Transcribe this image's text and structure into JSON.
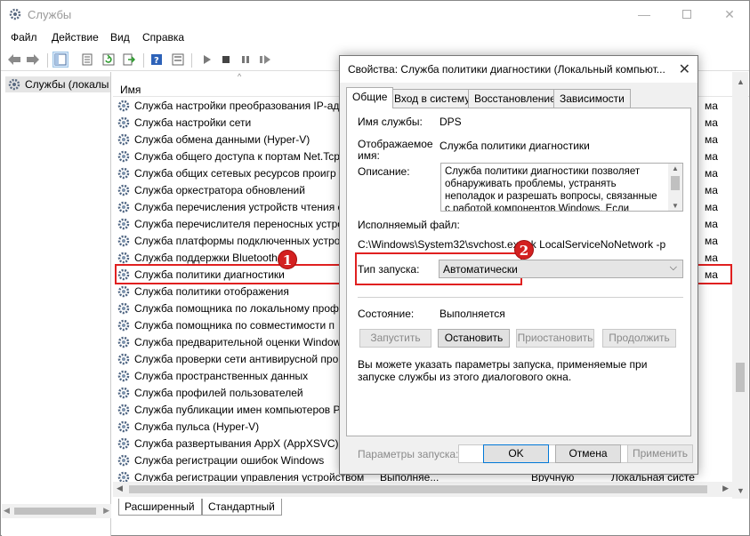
{
  "window": {
    "title": "Службы",
    "minimize": "—",
    "close": "✕"
  },
  "menu": [
    "Файл",
    "Действие",
    "Вид",
    "Справка"
  ],
  "tree": {
    "root_label": "Службы (локалы"
  },
  "list": {
    "column_name": "Имя",
    "rows": [
      {
        "name": "Служба настройки преобразования IP-ад"
      },
      {
        "name": "Служба настройки сети"
      },
      {
        "name": "Служба обмена данными (Hyper-V)"
      },
      {
        "name": "Служба общего доступа к портам Net.Tcp"
      },
      {
        "name": "Служба общих сетевых ресурсов проигр"
      },
      {
        "name": "Служба оркестратора обновлений"
      },
      {
        "name": "Служба перечисления устройств чтения с"
      },
      {
        "name": "Служба перечислителя переносных устро"
      },
      {
        "name": "Служба платформы подключенных устрой"
      },
      {
        "name": "Служба поддержки Bluetooth"
      },
      {
        "name": "Служба политики диагностики",
        "selected": true
      },
      {
        "name": "Служба политики отображения"
      },
      {
        "name": "Служба помощника по локальному проф"
      },
      {
        "name": "Служба помощника по совместимости п"
      },
      {
        "name": "Служба предварительной оценки Window"
      },
      {
        "name": "Служба проверки сети антивирусной про"
      },
      {
        "name": "Служба пространственных данных"
      },
      {
        "name": "Служба профилей пользователей"
      },
      {
        "name": "Служба публикации имен компьютеров P"
      },
      {
        "name": "Служба пульса (Hyper-V)"
      },
      {
        "name": "Служба развертывания AppX (AppXSVC)"
      },
      {
        "name": "Служба регистрации ошибок Windows"
      },
      {
        "name": "Служба регистрации управления устройством",
        "status": "Выполняе...",
        "type": "Вручную",
        "logon": "Локальная систе"
      }
    ],
    "right_fragments": [
      "ма",
      "ма",
      "ма",
      "ма",
      "ма",
      "ма",
      "ма",
      "ма",
      "ма",
      "ма",
      "ма"
    ]
  },
  "bottom_tabs": {
    "extended": "Расширенный",
    "standard": "Стандартный"
  },
  "dialog": {
    "title": "Свойства: Служба политики диагностики (Локальный компьют...",
    "close": "✕",
    "tabs": [
      "Общие",
      "Вход в систему",
      "Восстановление",
      "Зависимости"
    ],
    "service_name_label": "Имя службы:",
    "service_name": "DPS",
    "display_name_label_1": "Отображаемое",
    "display_name_label_2": "имя:",
    "display_name": "Служба политики диагностики",
    "description_label": "Описание:",
    "description": "Служба политики диагностики позволяет обнаруживать проблемы, устранять неполадок и разрешать вопросы, связанные с работой компонентов Windows.  Если остановить",
    "exe_label": "Исполняемый файл:",
    "exe_path": "C:\\Windows\\System32\\svchost.exe -k LocalServiceNoNetwork -p",
    "startup_label": "Тип запуска:",
    "startup_value": "Автоматически",
    "state_label": "Состояние:",
    "state_value": "Выполняется",
    "btn_start": "Запустить",
    "btn_stop": "Остановить",
    "btn_pause": "Приостановить",
    "btn_resume": "Продолжить",
    "hint": "Вы можете указать параметры запуска, применяемые при запуске службы из этого диалогового окна.",
    "params_label": "Параметры запуска:",
    "params_value": "",
    "btn_ok": "OK",
    "btn_cancel": "Отмена",
    "btn_apply": "Применить"
  },
  "callouts": {
    "one": "1",
    "two": "2"
  },
  "colors": {
    "highlight": "#e02020",
    "badge": "#d32020"
  }
}
